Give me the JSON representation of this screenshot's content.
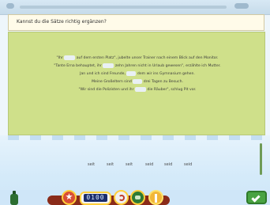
{
  "header": {
    "title": "Kannst du die Sätze richtig ergänzen?"
  },
  "exercise": {
    "lines": [
      {
        "parts": [
          "\"Ihr",
          "auf dem ersten Platz\", jubelte unser Trainer nach einem Blick auf den Monitor."
        ]
      },
      {
        "parts": [
          "\"Tante Erna behauptet, ihr",
          "zehn Jahren nicht in Urlaub gewesen\", erzählte ich Mutter."
        ]
      },
      {
        "parts": [
          "Jan und ich sind Freunde,",
          "dem wir ins Gymnasium gehen."
        ]
      },
      {
        "parts": [
          "Meine Großeltern sind",
          "drei Tagen zu Besuch."
        ]
      },
      {
        "parts": [
          "\"Wir sind die Polizisten und ihr",
          "die Räuber\", schlug Pit vor."
        ]
      }
    ]
  },
  "choices": [
    "seit",
    "seit",
    "seit",
    "seid",
    "seid",
    "seid"
  ],
  "toolbar": {
    "timer": "0100"
  },
  "colors": {
    "panel": "#cfe08a",
    "header_bg": "#fffbe9",
    "water": "#d4eaf9"
  }
}
